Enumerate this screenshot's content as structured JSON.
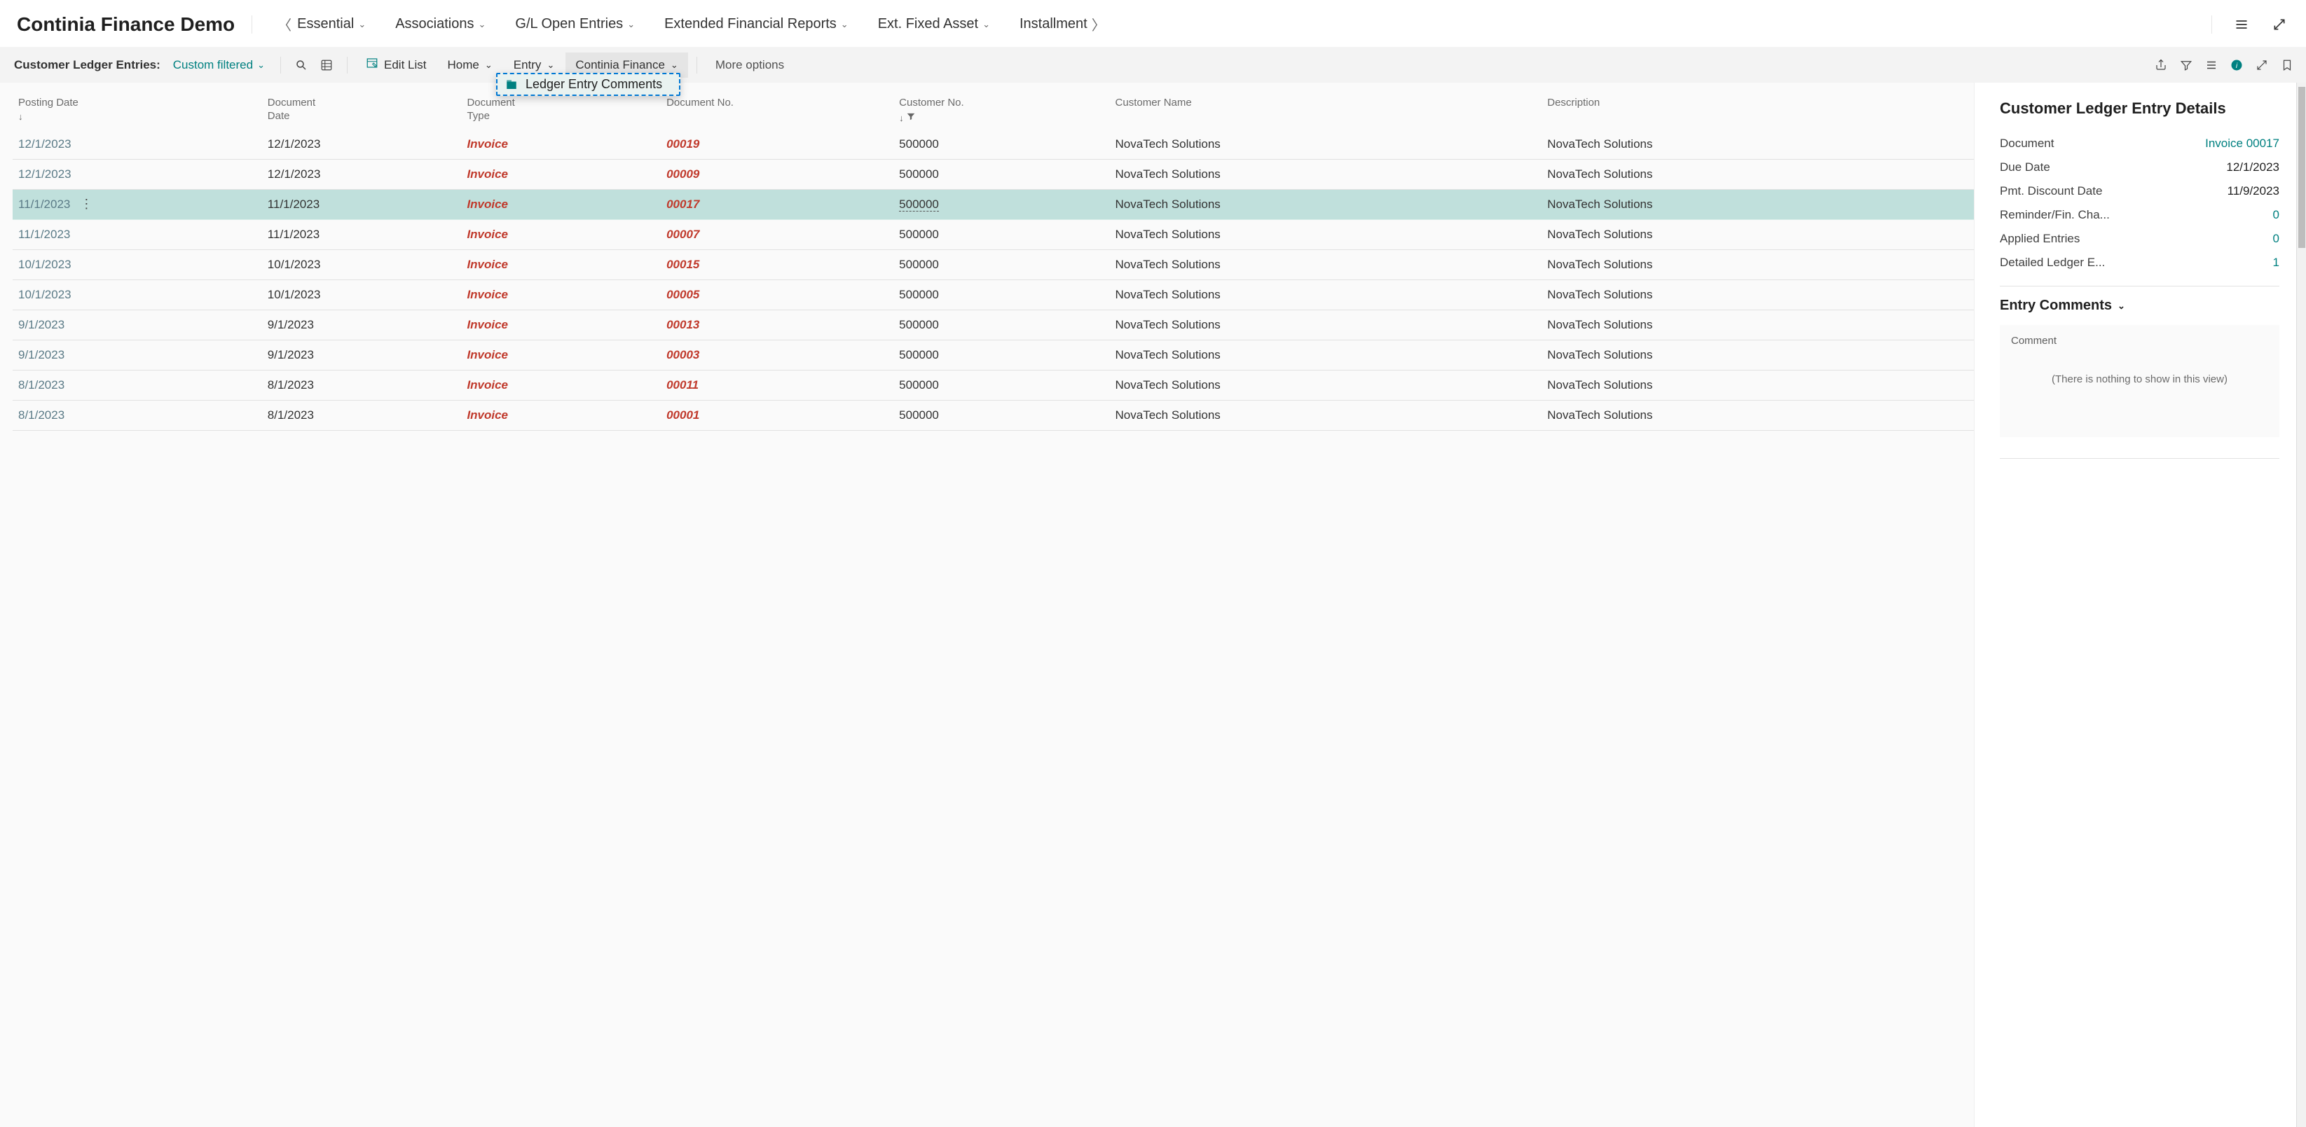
{
  "header": {
    "title": "Continia Finance Demo",
    "nav": {
      "essential": "Essential",
      "associations": "Associations",
      "gl_open_entries": "G/L Open Entries",
      "extended_reports": "Extended Financial Reports",
      "ext_fixed_asset": "Ext. Fixed Asset",
      "installment": "Installment"
    }
  },
  "toolbar": {
    "page_label": "Customer Ledger Entries:",
    "filter_state": "Custom filtered",
    "edit_list": "Edit List",
    "home": "Home",
    "entry": "Entry",
    "continia_finance": "Continia Finance",
    "more_options": "More options"
  },
  "dropdown": {
    "ledger_entry_comments": "Ledger Entry Comments"
  },
  "grid": {
    "columns": {
      "posting_date": "Posting Date",
      "document_date": "Document\nDate",
      "document_type": "Document\nType",
      "document_no": "Document No.",
      "customer_no": "Customer No.",
      "customer_name": "Customer Name",
      "description": "Description"
    },
    "rows": [
      {
        "posting_date": "12/1/2023",
        "document_date": "12/1/2023",
        "document_type": "Invoice",
        "document_no": "00019",
        "customer_no": "500000",
        "customer_name": "NovaTech Solutions",
        "description": "NovaTech Solutions"
      },
      {
        "posting_date": "12/1/2023",
        "document_date": "12/1/2023",
        "document_type": "Invoice",
        "document_no": "00009",
        "customer_no": "500000",
        "customer_name": "NovaTech Solutions",
        "description": "NovaTech Solutions"
      },
      {
        "posting_date": "11/1/2023",
        "document_date": "11/1/2023",
        "document_type": "Invoice",
        "document_no": "00017",
        "customer_no": "500000",
        "customer_name": "NovaTech Solutions",
        "description": "NovaTech Solutions",
        "selected": true
      },
      {
        "posting_date": "11/1/2023",
        "document_date": "11/1/2023",
        "document_type": "Invoice",
        "document_no": "00007",
        "customer_no": "500000",
        "customer_name": "NovaTech Solutions",
        "description": "NovaTech Solutions"
      },
      {
        "posting_date": "10/1/2023",
        "document_date": "10/1/2023",
        "document_type": "Invoice",
        "document_no": "00015",
        "customer_no": "500000",
        "customer_name": "NovaTech Solutions",
        "description": "NovaTech Solutions"
      },
      {
        "posting_date": "10/1/2023",
        "document_date": "10/1/2023",
        "document_type": "Invoice",
        "document_no": "00005",
        "customer_no": "500000",
        "customer_name": "NovaTech Solutions",
        "description": "NovaTech Solutions"
      },
      {
        "posting_date": "9/1/2023",
        "document_date": "9/1/2023",
        "document_type": "Invoice",
        "document_no": "00013",
        "customer_no": "500000",
        "customer_name": "NovaTech Solutions",
        "description": "NovaTech Solutions"
      },
      {
        "posting_date": "9/1/2023",
        "document_date": "9/1/2023",
        "document_type": "Invoice",
        "document_no": "00003",
        "customer_no": "500000",
        "customer_name": "NovaTech Solutions",
        "description": "NovaTech Solutions"
      },
      {
        "posting_date": "8/1/2023",
        "document_date": "8/1/2023",
        "document_type": "Invoice",
        "document_no": "00011",
        "customer_no": "500000",
        "customer_name": "NovaTech Solutions",
        "description": "NovaTech Solutions"
      },
      {
        "posting_date": "8/1/2023",
        "document_date": "8/1/2023",
        "document_type": "Invoice",
        "document_no": "00001",
        "customer_no": "500000",
        "customer_name": "NovaTech Solutions",
        "description": "NovaTech Solutions"
      }
    ]
  },
  "details": {
    "title": "Customer Ledger Entry Details",
    "fields": {
      "document_label": "Document",
      "document_value": "Invoice 00017",
      "due_date_label": "Due Date",
      "due_date_value": "12/1/2023",
      "pmt_disc_label": "Pmt. Discount Date",
      "pmt_disc_value": "11/9/2023",
      "reminder_label": "Reminder/Fin. Cha...",
      "reminder_value": "0",
      "applied_label": "Applied Entries",
      "applied_value": "0",
      "detailed_label": "Detailed Ledger E...",
      "detailed_value": "1"
    },
    "comments": {
      "section_title": "Entry Comments",
      "field_label": "Comment",
      "empty_text": "(There is nothing to show in this view)"
    }
  }
}
